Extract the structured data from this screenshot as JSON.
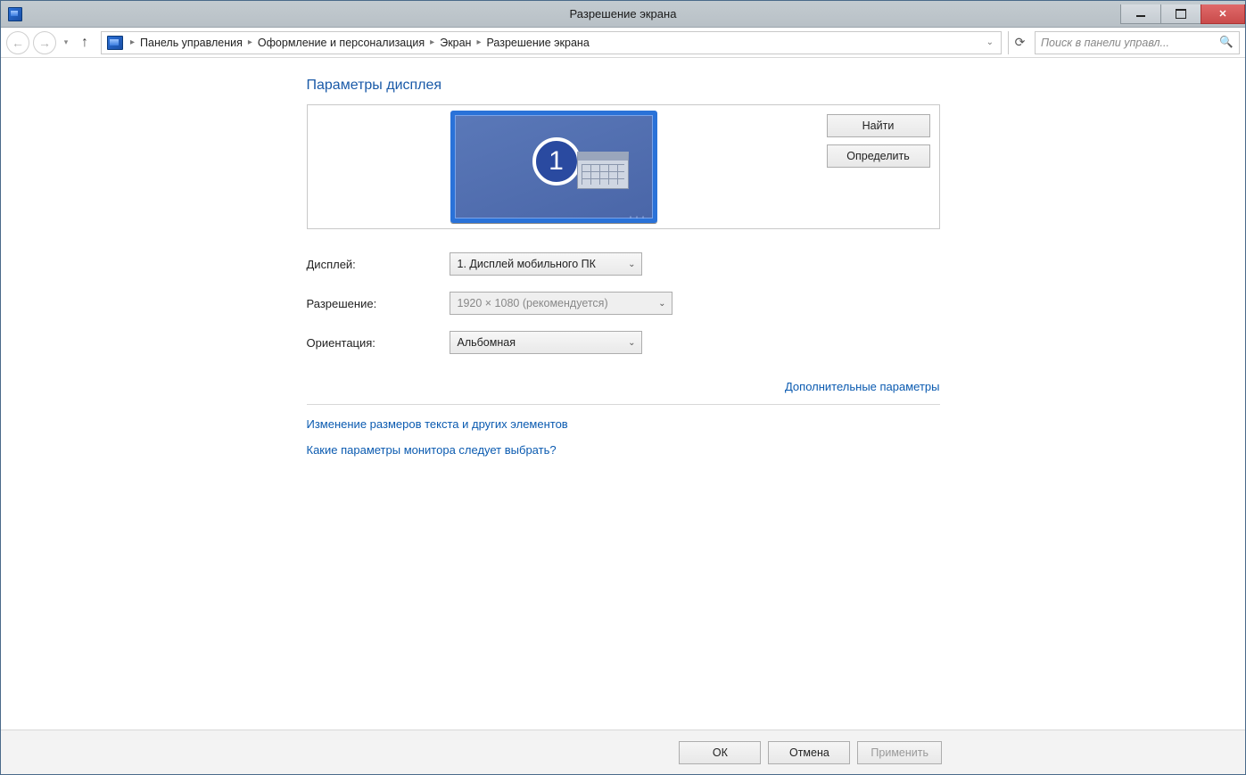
{
  "window": {
    "title": "Разрешение экрана"
  },
  "breadcrumb": {
    "items": [
      "Панель управления",
      "Оформление и персонализация",
      "Экран",
      "Разрешение экрана"
    ]
  },
  "search": {
    "placeholder": "Поиск в панели управл..."
  },
  "page": {
    "heading": "Параметры дисплея",
    "monitor_number": "1",
    "buttons": {
      "find": "Найти",
      "identify": "Определить"
    },
    "labels": {
      "display": "Дисплей:",
      "resolution": "Разрешение:",
      "orientation": "Ориентация:"
    },
    "values": {
      "display": "1. Дисплей мобильного ПК",
      "resolution": "1920 × 1080 (рекомендуется)",
      "orientation": "Альбомная"
    },
    "links": {
      "advanced": "Дополнительные параметры",
      "text_size": "Изменение размеров текста и других элементов",
      "help": "Какие параметры монитора следует выбрать?"
    }
  },
  "footer": {
    "ok": "ОК",
    "cancel": "Отмена",
    "apply": "Применить"
  }
}
